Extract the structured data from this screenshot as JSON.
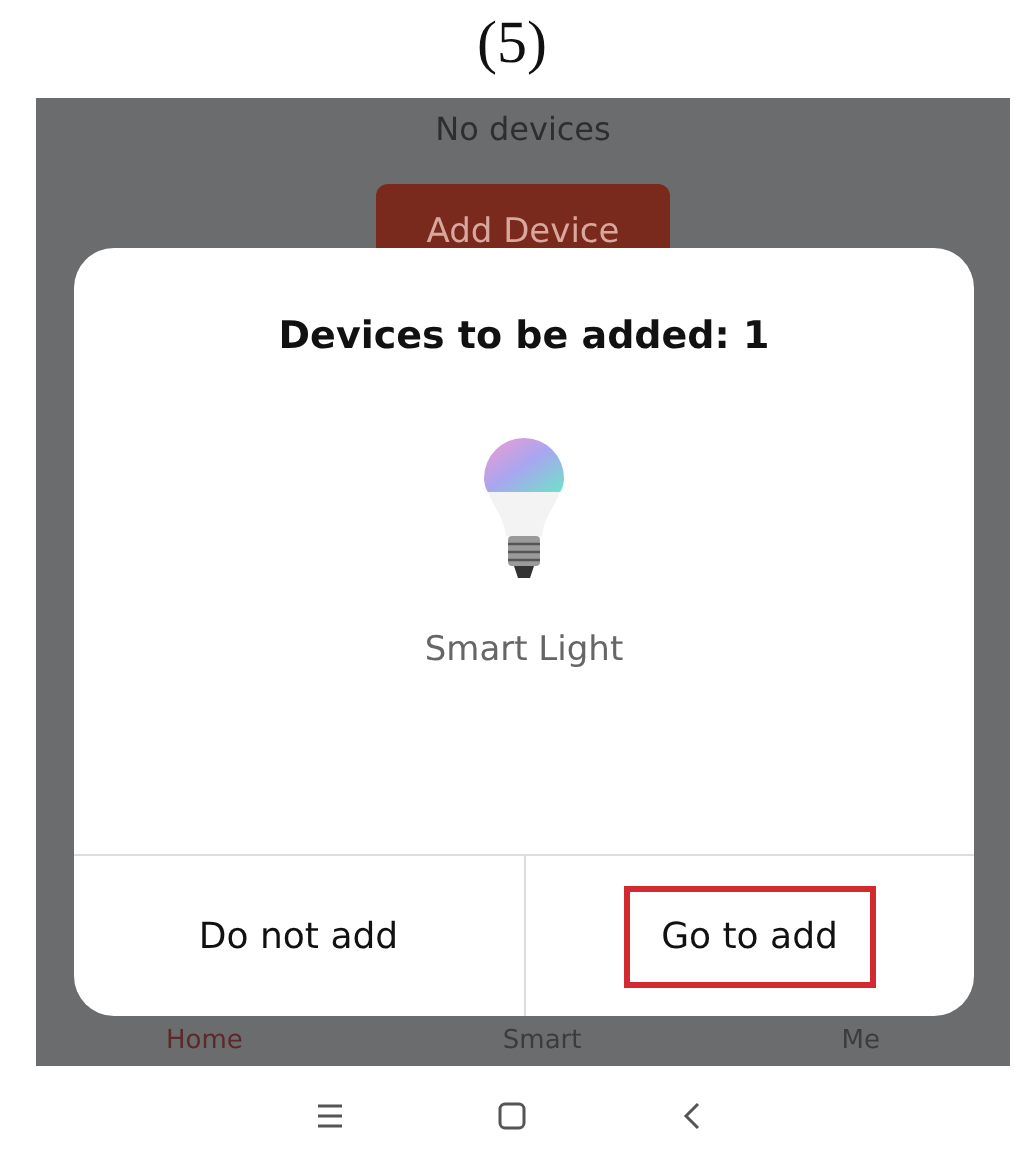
{
  "caption": "(5)",
  "background": {
    "empty_text": "No devices",
    "add_button": "Add Device"
  },
  "dialog": {
    "title": "Devices to be added: 1",
    "device": {
      "name": "Smart Light"
    },
    "buttons": [
      {
        "label": "Do not add",
        "highlighted": false
      },
      {
        "label": "Go to add",
        "highlighted": true
      }
    ]
  },
  "tabs": [
    {
      "label": "Home",
      "selected": true
    },
    {
      "label": "Smart",
      "selected": false
    },
    {
      "label": "Me",
      "selected": false
    }
  ],
  "nav_bar": {
    "buttons": [
      {
        "kind": "menu"
      },
      {
        "kind": "home"
      },
      {
        "kind": "back"
      }
    ]
  }
}
